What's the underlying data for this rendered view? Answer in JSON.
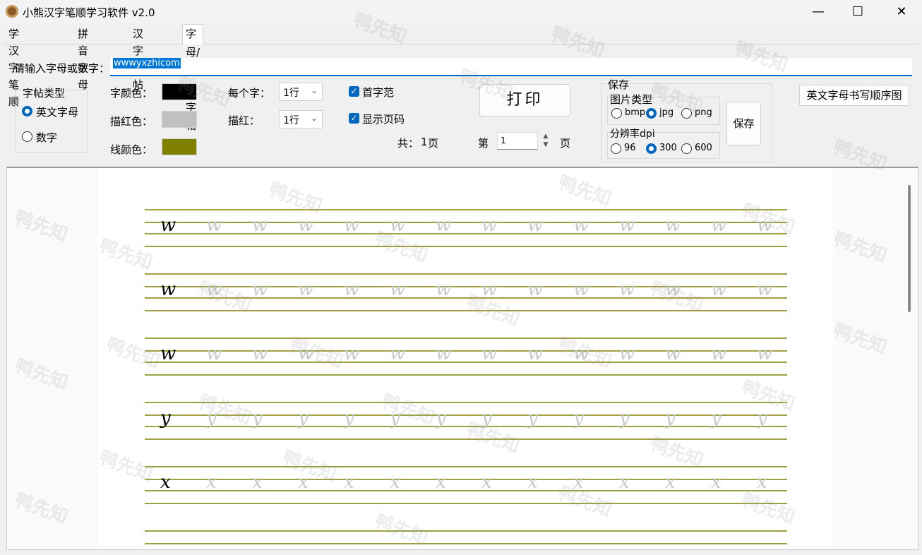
{
  "window": {
    "title": "小熊汉字笔顺学习软件 v2.0",
    "minimize": "—",
    "maximize": "☐",
    "close": "✕"
  },
  "tabs": [
    "学汉字笔顺",
    "拼音字母",
    "汉字字帖",
    "字母/数字字帖"
  ],
  "input": {
    "label": "请输入字母或数字：",
    "value": "wwwyxzhicom"
  },
  "type_group": {
    "title": "字帖类型",
    "options": [
      "英文字母",
      "数字"
    ],
    "selected": "英文字母"
  },
  "colors": {
    "char_label": "字颜色：",
    "char": "#000000",
    "trace_label": "描红色：",
    "trace": "#c0c0c0",
    "line_label": "线颜色：",
    "line": "#808000"
  },
  "per_char": {
    "label": "每个字：",
    "value": "1行"
  },
  "trace_rows": {
    "label": "描红：",
    "value": "1行"
  },
  "checks": {
    "first_sample": "首字范",
    "show_page_no": "显示页码"
  },
  "print_button": "打印",
  "pages": {
    "total_prefix": "共：",
    "total": "1",
    "total_suffix": "页",
    "current_prefix": "第",
    "current": "1",
    "current_suffix": "页"
  },
  "save": {
    "title": "保存",
    "image_type_title": "图片类型",
    "image_types": [
      "bmp",
      "jpg",
      "png"
    ],
    "image_type_selected": "jpg",
    "dpi_title": "分辨率dpi",
    "dpis": [
      "96",
      "300",
      "600"
    ],
    "dpi_selected": "300",
    "button": "保存"
  },
  "stroke_order_button": "英文字母书写顺序图",
  "preview_rows": [
    {
      "letter": "w"
    },
    {
      "letter": "w"
    },
    {
      "letter": "w"
    },
    {
      "letter": "y"
    },
    {
      "letter": "x"
    }
  ],
  "watermark": "鸭先知"
}
